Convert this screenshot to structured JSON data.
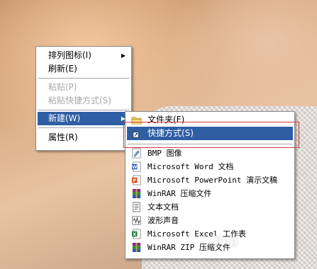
{
  "context_menu": {
    "items": [
      {
        "label": "排列图标(I)",
        "submenu": true,
        "disabled": false
      },
      {
        "label": "刷新(E)",
        "disabled": false
      },
      {
        "label": "粘贴(P)",
        "disabled": true
      },
      {
        "label": "粘贴快捷方式(S)",
        "disabled": true
      },
      {
        "label": "新建(W)",
        "submenu": true,
        "highlighted": true
      },
      {
        "label": "属性(R)",
        "disabled": false
      }
    ]
  },
  "new_submenu": {
    "items": [
      {
        "label": "文件夹(F)",
        "icon": "folder-icon"
      },
      {
        "label": "快捷方式(S)",
        "icon": "shortcut-icon",
        "highlighted": true
      },
      {
        "label": "BMP 图像",
        "icon": "bmp-image-icon"
      },
      {
        "label": "Microsoft Word 文档",
        "icon": "word-document-icon"
      },
      {
        "label": "Microsoft PowerPoint 演示文稿",
        "icon": "powerpoint-icon"
      },
      {
        "label": "WinRAR 压缩文件",
        "icon": "winrar-icon"
      },
      {
        "label": "文本文档",
        "icon": "text-document-icon"
      },
      {
        "label": "波形声音",
        "icon": "wave-sound-icon"
      },
      {
        "label": "Microsoft Excel 工作表",
        "icon": "excel-icon"
      },
      {
        "label": "WinRAR ZIP 压缩文件",
        "icon": "winrar-zip-icon"
      }
    ]
  },
  "colors": {
    "highlight": "#2f5ea4",
    "annotation_box": "#d4373f"
  },
  "watermark": "jing"
}
